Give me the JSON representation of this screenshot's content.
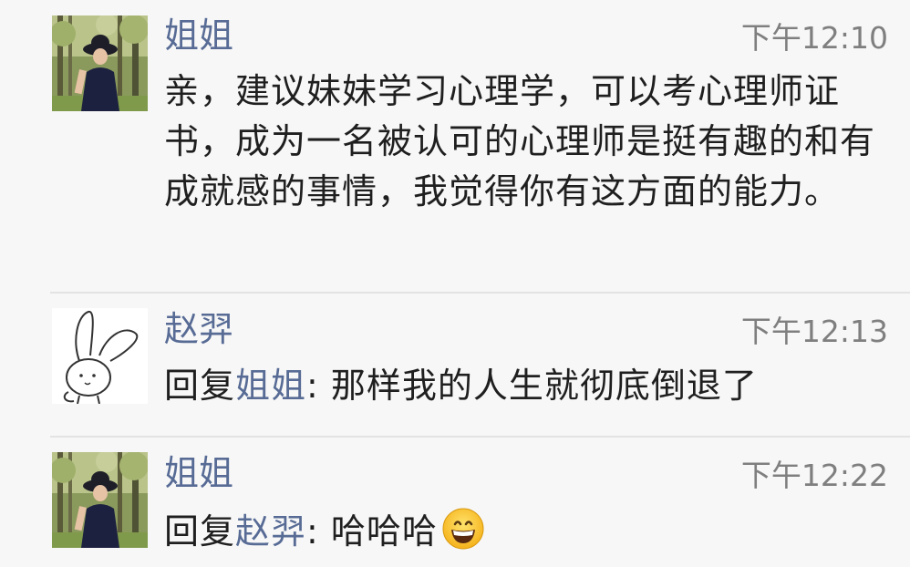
{
  "comments": [
    {
      "author": "姐姐",
      "time": "下午12:10",
      "text": "亲，建议妹妹学习心理学，可以考心理师证书，成为一名被认可的心理师是挺有趣的和有成就感的事情，我觉得你有这方面的能力。",
      "avatar": "woman-in-hat-photo"
    },
    {
      "author": "赵羿",
      "time": "下午12:13",
      "reply_prefix": "回复",
      "reply_to": "姐姐",
      "reply_separator": ": ",
      "text": "那样我的人生就彻底倒退了",
      "avatar": "rabbit-doodle"
    },
    {
      "author": "姐姐",
      "time": "下午12:22",
      "reply_prefix": "回复",
      "reply_to": "赵羿",
      "reply_separator": ": ",
      "text": "哈哈哈",
      "emoji": "grinning-face-emoji",
      "avatar": "woman-in-hat-photo"
    }
  ],
  "colors": {
    "background": "#f7f7f7",
    "author_name": "#576b95",
    "timestamp": "#7f7f7f",
    "body_text": "#1f1f1f",
    "divider": "#e3e3e3"
  }
}
